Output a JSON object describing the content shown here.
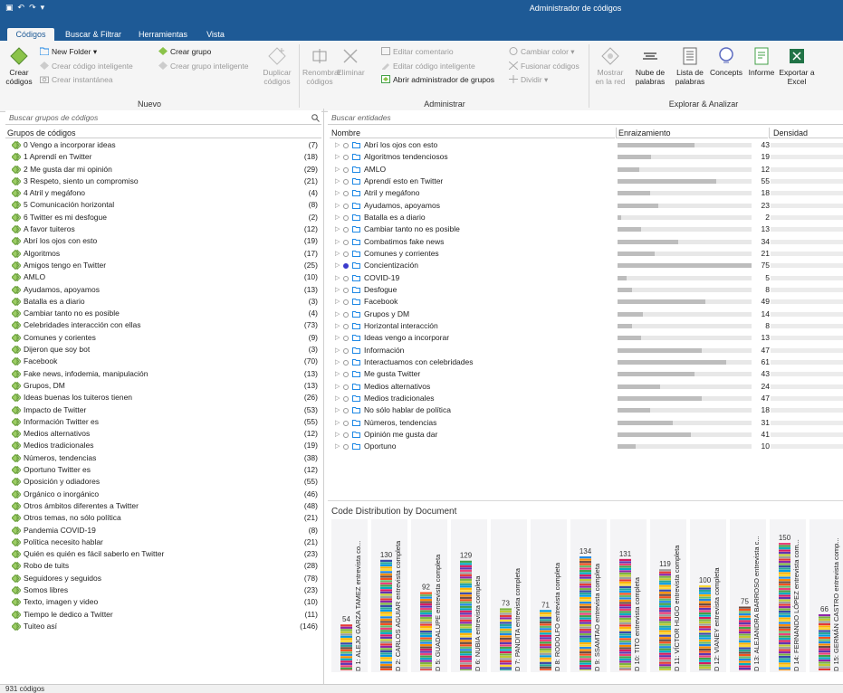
{
  "app_title": "Administrador de códigos",
  "tabs": [
    "Códigos",
    "Buscar & Filtrar",
    "Herramientas",
    "Vista"
  ],
  "ribbon": {
    "nuevo": {
      "label": "Nuevo",
      "crear_codigos": "Crear códigos",
      "new_folder": "New Folder",
      "crear_codigo_inteligente": "Crear código inteligente",
      "crear_instantanea": "Crear instantánea",
      "crear_grupo": "Crear grupo",
      "crear_grupo_inteligente": "Crear grupo inteligente",
      "duplicar_codigos": "Duplicar códigos"
    },
    "administrar": {
      "label": "Administrar",
      "renombrar_codigos": "Renombrar códigos",
      "eliminar": "Eliminar",
      "editar_comentario": "Editar comentario",
      "editar_codigo_inteligente": "Editar código inteligente",
      "abrir_admin_grupos": "Abrir administrador de grupos",
      "cambiar_color": "Cambiar color",
      "fusionar_codigos": "Fusionar códigos",
      "dividir": "Dividir"
    },
    "explorar": {
      "label": "Explorar & Analizar",
      "mostrar_red": "Mostrar en la red",
      "nube_palabras": "Nube de palabras",
      "lista_palabras": "Lista de palabras",
      "concepts": "Concepts",
      "informe": "Informe",
      "exportar_excel": "Exportar a Excel"
    }
  },
  "left_panel": {
    "search_placeholder": "Buscar grupos de códigos",
    "column_header": "Grupos de códigos",
    "groups": [
      {
        "name": "0 Vengo a incorporar ideas",
        "count": "(7)"
      },
      {
        "name": "1 Aprendí en Twitter",
        "count": "(18)"
      },
      {
        "name": "2 Me gusta dar mi opinión",
        "count": "(29)"
      },
      {
        "name": "3 Respeto, siento un compromiso",
        "count": "(21)"
      },
      {
        "name": "4 Atril y megáfono",
        "count": "(4)"
      },
      {
        "name": "5 Comunicación horizontal",
        "count": "(8)"
      },
      {
        "name": "6 Twitter es mi desfogue",
        "count": "(2)"
      },
      {
        "name": "A favor tuiteros",
        "count": "(12)"
      },
      {
        "name": "Abrí los ojos con esto",
        "count": "(19)"
      },
      {
        "name": "Algoritmos",
        "count": "(17)"
      },
      {
        "name": "Amigos tengo en Twitter",
        "count": "(25)"
      },
      {
        "name": "AMLO",
        "count": "(10)"
      },
      {
        "name": "Ayudamos, apoyamos",
        "count": "(13)"
      },
      {
        "name": "Batalla es a diario",
        "count": "(3)"
      },
      {
        "name": "Cambiar tanto no es posible",
        "count": "(4)"
      },
      {
        "name": "Celebridades interacción con ellas",
        "count": "(73)"
      },
      {
        "name": "Comunes y corientes",
        "count": "(9)"
      },
      {
        "name": "Dijeron que soy bot",
        "count": "(3)"
      },
      {
        "name": "Facebook",
        "count": "(70)"
      },
      {
        "name": "Fake news, infodemia, manipulación",
        "count": "(13)"
      },
      {
        "name": "Grupos, DM",
        "count": "(13)"
      },
      {
        "name": "Ideas buenas los tuiteros tienen",
        "count": "(26)"
      },
      {
        "name": "Impacto de Twitter",
        "count": "(53)"
      },
      {
        "name": "Información Twitter es",
        "count": "(55)"
      },
      {
        "name": "Medios alternativos",
        "count": "(12)"
      },
      {
        "name": "Medios tradicionales",
        "count": "(19)"
      },
      {
        "name": "Números, tendencias",
        "count": "(38)"
      },
      {
        "name": "Oportuno Twitter es",
        "count": "(12)"
      },
      {
        "name": "Oposición y odiadores",
        "count": "(55)"
      },
      {
        "name": "Orgánico o inorgánico",
        "count": "(46)"
      },
      {
        "name": "Otros ámbitos diferentes a Twitter",
        "count": "(48)"
      },
      {
        "name": "Otros temas, no sólo política",
        "count": "(21)"
      },
      {
        "name": "Pandemia COVID-19",
        "count": "(8)"
      },
      {
        "name": "Política necesito hablar",
        "count": "(21)"
      },
      {
        "name": "Quién es quién es fácil saberlo en Twitter",
        "count": "(23)"
      },
      {
        "name": "Robo de tuits",
        "count": "(28)"
      },
      {
        "name": "Seguidores y seguidos",
        "count": "(78)"
      },
      {
        "name": "Somos libres",
        "count": "(23)"
      },
      {
        "name": "Texto, imagen y video",
        "count": "(10)"
      },
      {
        "name": "Tiempo le dedico a Twitter",
        "count": "(11)"
      },
      {
        "name": "Tuiteo así",
        "count": "(146)"
      }
    ]
  },
  "right_panel": {
    "search_placeholder": "Buscar entidades",
    "columns": {
      "name": "Nombre",
      "rooting": "Enraizamiento",
      "density": "Densidad"
    },
    "entities": [
      {
        "name": "Abrí los ojos con esto",
        "rooting": 43,
        "selected": false
      },
      {
        "name": "Algoritmos tendenciosos",
        "rooting": 19,
        "selected": false
      },
      {
        "name": "AMLO",
        "rooting": 12,
        "selected": false
      },
      {
        "name": "Aprendí esto en Twitter",
        "rooting": 55,
        "selected": false
      },
      {
        "name": "Atril y megáfono",
        "rooting": 18,
        "selected": false
      },
      {
        "name": "Ayudamos, apoyamos",
        "rooting": 23,
        "selected": false
      },
      {
        "name": "Batalla es a diario",
        "rooting": 2,
        "selected": false
      },
      {
        "name": "Cambiar tanto no es posible",
        "rooting": 13,
        "selected": false
      },
      {
        "name": "Combatimos fake news",
        "rooting": 34,
        "selected": false
      },
      {
        "name": "Comunes y corrientes",
        "rooting": 21,
        "selected": false
      },
      {
        "name": "Concientización",
        "rooting": 75,
        "selected": true
      },
      {
        "name": "COVID-19",
        "rooting": 5,
        "selected": false
      },
      {
        "name": "Desfogue",
        "rooting": 8,
        "selected": false
      },
      {
        "name": "Facebook",
        "rooting": 49,
        "selected": false
      },
      {
        "name": "Grupos y DM",
        "rooting": 14,
        "selected": false
      },
      {
        "name": "Horizontal interacción",
        "rooting": 8,
        "selected": false
      },
      {
        "name": "Ideas vengo a incorporar",
        "rooting": 13,
        "selected": false
      },
      {
        "name": "Información",
        "rooting": 47,
        "selected": false
      },
      {
        "name": "Interactuamos con celebridades",
        "rooting": 61,
        "selected": false
      },
      {
        "name": "Me gusta Twitter",
        "rooting": 43,
        "selected": false
      },
      {
        "name": "Medios alternativos",
        "rooting": 24,
        "selected": false
      },
      {
        "name": "Medios tradicionales",
        "rooting": 47,
        "selected": false
      },
      {
        "name": "No sólo hablar de política",
        "rooting": 18,
        "selected": false
      },
      {
        "name": "Números, tendencias",
        "rooting": 31,
        "selected": false
      },
      {
        "name": "Opinión me gusta dar",
        "rooting": 41,
        "selected": false
      },
      {
        "name": "Oportuno",
        "rooting": 10,
        "selected": false
      }
    ]
  },
  "chart_data": {
    "type": "bar",
    "title": "Code Distribution by Document",
    "categories": [
      "D 1: ALEJO GARZA TAMEZ entrevista co...",
      "D 2: CARLOS AGUIAR entrevista completa",
      "D 5: GUADALUPE entrevista completa",
      "D 6: NUBIA entrevista completa",
      "D 7: PANDITA entrevista completa",
      "D 8: RODOLFO entrevista completa",
      "D 9: SSAMTAO entrevista completa",
      "D 10: TITO entrevista completa",
      "D 11: VÍCTOR HUGO entrevista completa",
      "D 12: VIANEY entrevista completa",
      "D 13: ALEJANDRA BARROSO entrevista c...",
      "D 14: FERNANDO LÓPEZ entrevista com...",
      "D 15: GERMÁN CASTRO entrevista comp..."
    ],
    "values": [
      54,
      130,
      92,
      129,
      73,
      71,
      134,
      131,
      119,
      100,
      75,
      150,
      66
    ],
    "ylim": [
      0,
      150
    ]
  },
  "palette": [
    "#e53935",
    "#43a047",
    "#1e88e5",
    "#fdd835",
    "#8e24aa",
    "#00acc1",
    "#fb8c00",
    "#3949ab",
    "#7cb342",
    "#d81b60",
    "#6d4c41",
    "#26a69a",
    "#c0ca33",
    "#5e35b1",
    "#f4511e",
    "#039be5",
    "#9e9e9e",
    "#ec407a",
    "#66bb6a",
    "#ffb300"
  ],
  "status": "931 códigos"
}
